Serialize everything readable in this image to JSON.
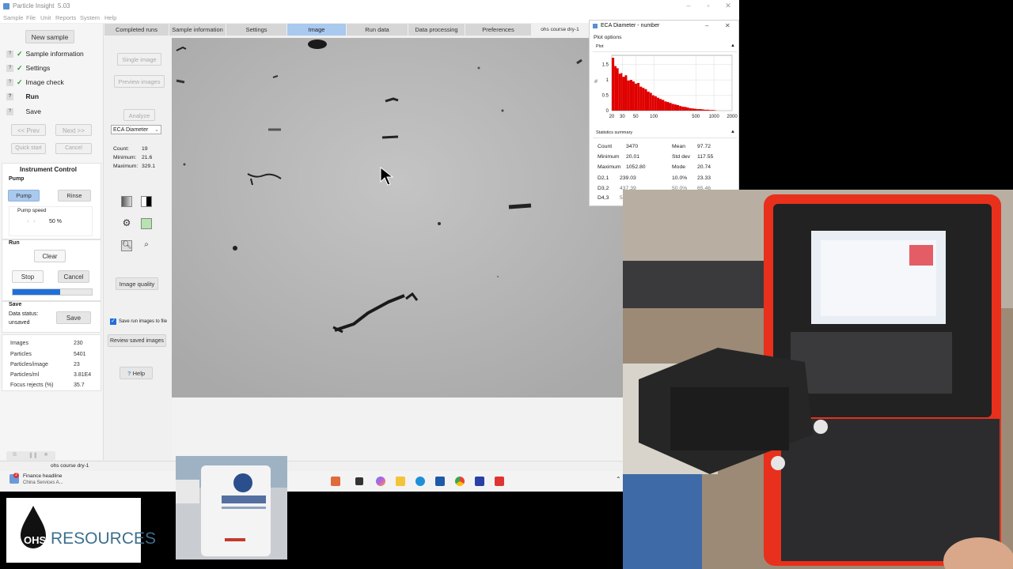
{
  "app": {
    "title": "Particle Insight",
    "version": "5.03",
    "menu": [
      "Sample",
      "File",
      "Unit",
      "Reports",
      "System",
      "Help"
    ]
  },
  "left_panel": {
    "new_sample": "New sample",
    "steps": [
      {
        "label": "Sample information",
        "checked": true
      },
      {
        "label": "Settings",
        "checked": true
      },
      {
        "label": "Image check",
        "checked": true
      },
      {
        "label": "Run",
        "checked": false,
        "bold": true
      },
      {
        "label": "Save",
        "checked": false
      }
    ],
    "prev": "<< Prev",
    "next": "Next >>",
    "quick_start": "Quick start",
    "cancel_top": "Cancel",
    "instrument_control": "Instrument Control",
    "pump_section": "Pump",
    "pump_button": "Pump",
    "rinse_button": "Rinse",
    "pump_speed_label": "Pump speed",
    "pump_speed_value": "50 %",
    "run_section": "Run",
    "clear_button": "Clear",
    "stop_button": "Stop",
    "cancel_button": "Cancel",
    "run_progress": 0.6,
    "save_section": "Save",
    "data_status_label": "Data status:",
    "data_status_value": "unsaved",
    "save_button": "Save",
    "stats": [
      {
        "label": "Images",
        "value": "230"
      },
      {
        "label": "Particles",
        "value": "5401"
      },
      {
        "label": "Particles/image",
        "value": "23"
      },
      {
        "label": "Particles/ml",
        "value": "3.81E4"
      },
      {
        "label": "Focus rejects (%)",
        "value": "35.7"
      }
    ]
  },
  "tools": {
    "single_image": "Single image",
    "preview_images": "Preview images",
    "analyze": "Analyze",
    "measure_select": "ECA Diameter",
    "count_label": "Count:",
    "count_value": "19",
    "min_label": "Minimum:",
    "min_value": "21.6",
    "max_label": "Maximum:",
    "max_value": "329.1",
    "image_quality": "Image quality",
    "save_run_images": "Save run images to file",
    "save_run_checked": true,
    "review_saved": "Review saved images",
    "help": "Help"
  },
  "tabs": [
    {
      "label": "Completed runs"
    },
    {
      "label": "Sample information"
    },
    {
      "label": "Settings"
    },
    {
      "label": "Image",
      "active": true
    },
    {
      "label": "Run data"
    },
    {
      "label": "Data processing"
    },
    {
      "label": "Preferences"
    },
    {
      "label": "ohs course dry-1",
      "plain": true
    }
  ],
  "status_bar": {
    "sample_name": "ohs course dry-1"
  },
  "taskbar": {
    "news_title": "Finance headline",
    "news_sub": "China Services A..."
  },
  "histogram_window": {
    "title": "ECA Diameter - number",
    "plot_options": "Plot options",
    "plot_label": "Plot",
    "stats_title": "Statistics summary",
    "stats_left": [
      {
        "label": "Count",
        "value": "3470"
      },
      {
        "label": "Minimum",
        "value": "20.01"
      },
      {
        "label": "Maximum",
        "value": "1052.80"
      },
      {
        "label": "D2,1",
        "value": "239.03"
      },
      {
        "label": "D3,2",
        "value": "437.39"
      },
      {
        "label": "D4,3",
        "value": "5..."
      }
    ],
    "stats_right": [
      {
        "label": "Mean",
        "value": "97.72"
      },
      {
        "label": "Std dev",
        "value": "117.55"
      },
      {
        "label": "Mode",
        "value": "20.74"
      },
      {
        "label": "10.0%",
        "value": "23.33"
      },
      {
        "label": "50.0%",
        "value": "65.46"
      }
    ]
  },
  "chart_data": {
    "type": "bar",
    "title": "",
    "xlabel": "",
    "ylabel": "%",
    "x_scale": "log",
    "xlim": [
      20,
      2000
    ],
    "ylim": [
      0,
      1.8
    ],
    "x_ticks": [
      "20",
      "30",
      "50",
      "100",
      "500",
      "1000",
      "2000"
    ],
    "x_tick_values": [
      20,
      30,
      50,
      100,
      500,
      1000,
      2000
    ],
    "y_ticks": [
      "0",
      "0.5",
      "1",
      "1.5"
    ],
    "y_tick_values": [
      0,
      0.5,
      1,
      1.5
    ],
    "grid": true,
    "color": "#e00000",
    "bins_x": [
      20,
      22,
      24,
      26,
      28,
      30,
      33,
      36,
      40,
      44,
      48,
      53,
      58,
      64,
      70,
      77,
      85,
      93,
      102,
      112,
      123,
      135,
      149,
      164,
      180,
      198,
      218,
      240,
      264,
      290,
      319,
      351,
      386,
      425,
      467,
      514,
      565,
      622,
      684,
      752,
      827,
      910,
      1001,
      1050
    ],
    "bins_y": [
      1.72,
      1.45,
      1.38,
      1.2,
      1.22,
      1.1,
      1.15,
      0.98,
      1.0,
      0.95,
      0.88,
      0.9,
      0.78,
      0.74,
      0.7,
      0.62,
      0.58,
      0.5,
      0.47,
      0.42,
      0.38,
      0.35,
      0.3,
      0.28,
      0.25,
      0.22,
      0.2,
      0.18,
      0.15,
      0.13,
      0.12,
      0.1,
      0.08,
      0.07,
      0.06,
      0.05,
      0.05,
      0.04,
      0.03,
      0.03,
      0.02,
      0.02,
      0.015,
      0.01
    ]
  },
  "overlays": {
    "logo_text": "RESOURCES",
    "logo_prefix": "OHS"
  },
  "colors": {
    "accent_tab": "#a9c9ee",
    "pump_active": "#a9c9ee",
    "progress": "#1e6fd9",
    "histogram": "#e00000",
    "case_red": "#e8301c"
  }
}
